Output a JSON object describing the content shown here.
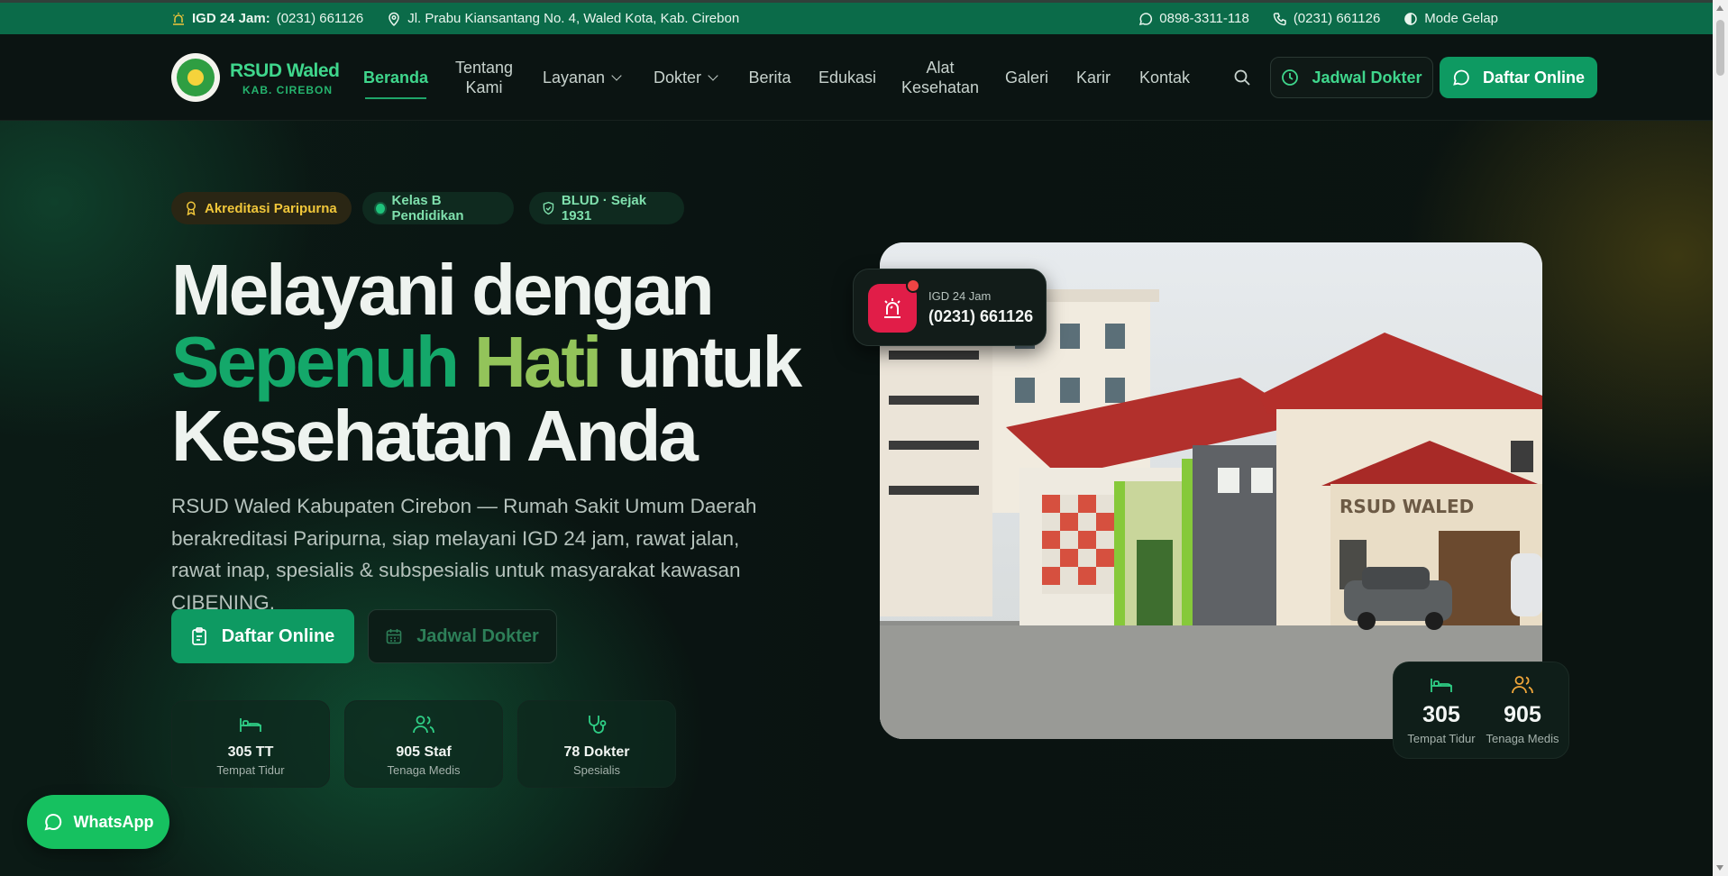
{
  "topbar": {
    "igd_label": "IGD 24 Jam:",
    "igd_phone": "(0231) 661126",
    "address": "Jl. Prabu Kiansantang No. 4, Waled Kota, Kab. Cirebon",
    "whatsapp": "0898-3311-118",
    "phone": "(0231) 661126",
    "dark_mode": "Mode Gelap"
  },
  "brand": {
    "name": "RSUD Waled",
    "sub": "KAB. CIREBON",
    "logo_text": "RSUD WALED"
  },
  "nav": {
    "items": [
      {
        "label": "Beranda"
      },
      {
        "label": "Tentang Kami"
      },
      {
        "label": "Layanan"
      },
      {
        "label": "Dokter"
      },
      {
        "label": "Berita"
      },
      {
        "label": "Edukasi"
      },
      {
        "label": "Alat Kesehatan"
      },
      {
        "label": "Galeri"
      },
      {
        "label": "Karir"
      },
      {
        "label": "Kontak"
      }
    ],
    "jadwal_button": "Jadwal Dokter",
    "daftar_button": "Daftar Online"
  },
  "hero": {
    "badges": [
      "Akreditasi Paripurna",
      "Kelas B Pendidikan",
      "BLUD · Sejak 1931"
    ],
    "title_line1": "Melayani dengan",
    "title_green1": "Sepenuh",
    "title_green2": "Hati",
    "title_rest": "untuk",
    "title_line3": "Kesehatan Anda",
    "description": "RSUD Waled Kabupaten Cirebon — Rumah Sakit Umum Daerah berakreditasi Paripurna, siap melayani IGD 24 jam, rawat jalan, rawat inap, spesialis & subspesialis untuk masyarakat kawasan CIBENING.",
    "cta_primary": "Daftar Online",
    "cta_secondary": "Jadwal Dokter",
    "stats": [
      {
        "value": "305 TT",
        "label": "Tempat Tidur",
        "icon": "bed-icon"
      },
      {
        "value": "905 Staf",
        "label": "Tenaga Medis",
        "icon": "users-icon"
      },
      {
        "value": "78 Dokter",
        "label": "Spesialis",
        "icon": "stethoscope-icon"
      }
    ]
  },
  "igd_card": {
    "label": "IGD 24 Jam",
    "phone": "(0231) 661126"
  },
  "mini_stats": [
    {
      "value": "305",
      "label": "Tempat Tidur"
    },
    {
      "value": "905",
      "label": "Tenaga Medis"
    }
  ],
  "photo_sign": "RSUD WALED",
  "whatsapp_button": "WhatsApp",
  "colors": {
    "topbar": "#0b6b49",
    "accent": "#0e9a62",
    "accent_text": "#3fd68c",
    "gold": "#f0c63a",
    "emergency": "#e11d48",
    "whatsapp": "#16c160"
  }
}
